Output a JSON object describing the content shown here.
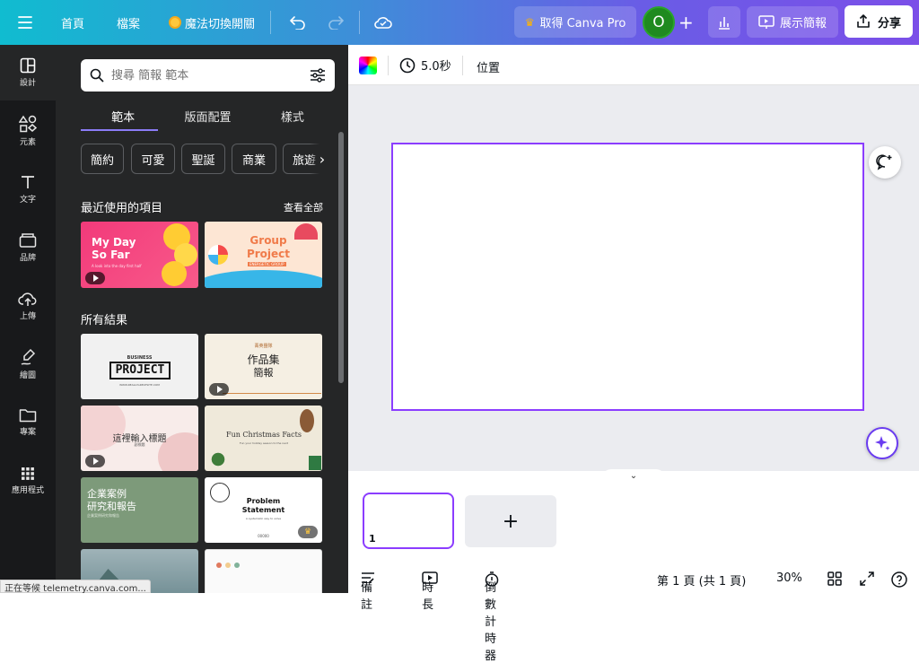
{
  "topbar": {
    "home": "首頁",
    "file": "檔案",
    "magic_switch": "魔法切換開關",
    "get_pro": "取得 Canva Pro",
    "avatar_initial": "O",
    "present": "展示簡報",
    "share": "分享"
  },
  "rail": {
    "items": [
      {
        "label": "設計",
        "icon": "layout-icon"
      },
      {
        "label": "元素",
        "icon": "shapes-icon"
      },
      {
        "label": "文字",
        "icon": "text-icon"
      },
      {
        "label": "品牌",
        "icon": "brand-icon"
      },
      {
        "label": "上傳",
        "icon": "upload-cloud-icon"
      },
      {
        "label": "繪圖",
        "icon": "draw-icon"
      },
      {
        "label": "專案",
        "icon": "folder-icon"
      },
      {
        "label": "應用程式",
        "icon": "apps-grid-icon"
      }
    ]
  },
  "panel": {
    "search_placeholder": "搜尋 簡報 範本",
    "tabs": [
      "範本",
      "版面配置",
      "樣式"
    ],
    "chips": [
      "簡約",
      "可愛",
      "聖誕",
      "商業",
      "旅遊"
    ],
    "recent_title": "最近使用的項目",
    "see_all": "查看全部",
    "all_results_title": "所有結果",
    "recent": [
      {
        "title": "My Day So Far",
        "sub": "A look into the day first half"
      },
      {
        "title": "Group Project",
        "sub": "ENERGETIC GROUP"
      }
    ],
    "results": [
      {
        "top": "BUSINESS",
        "title": "PROJECT",
        "sub": "WWW.REALLYGREATSITE.COM"
      },
      {
        "top": "菁英團隊",
        "title": "作品集",
        "title2": "簡報"
      },
      {
        "title": "這裡輸入標題",
        "sub": "副標題"
      },
      {
        "title": "Fun Christmas Facts",
        "sub": "Fun your holiday season to the next"
      },
      {
        "title": "企業案例",
        "title2": "研究和報告",
        "sub": "企業案例研究和報告"
      },
      {
        "title": "Problem",
        "title2": "Statement",
        "sub": "A systematic way to solve",
        "num": "00000"
      }
    ]
  },
  "toolbar": {
    "duration": "5.0秒",
    "position": "位置"
  },
  "pages": {
    "page_number": "1"
  },
  "bottom": {
    "notes": "備註",
    "timing": "時長",
    "timer": "倒數計時器",
    "page_indicator": "第 1 頁 (共 1 頁)",
    "zoom": "30%"
  },
  "status_bar": "正在等候 telemetry.canva.com..."
}
